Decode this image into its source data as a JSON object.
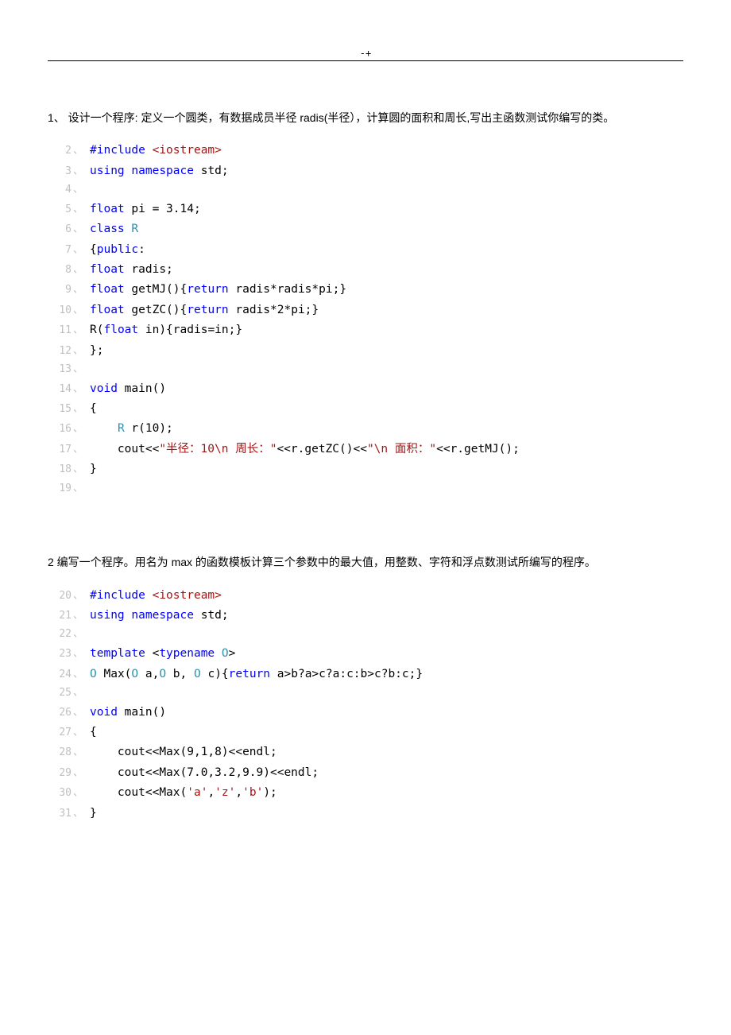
{
  "header": {
    "mark": "-+"
  },
  "q1": {
    "text": "1、 设计一个程序: 定义一个圆类，有数据成员半径 radis(半径），计算圆的面积和周长,写出主函数测试你编写的类。",
    "lines": [
      {
        "n": "2",
        "tokens": [
          [
            "pp",
            "#include "
          ],
          [
            "inc",
            "<iostream>"
          ]
        ]
      },
      {
        "n": "3",
        "tokens": [
          [
            "kw",
            "using"
          ],
          [
            "blk",
            " "
          ],
          [
            "kw",
            "namespace"
          ],
          [
            "blk",
            " std;"
          ]
        ]
      },
      {
        "n": "4",
        "tokens": []
      },
      {
        "n": "5",
        "tokens": [
          [
            "kw",
            "float"
          ],
          [
            "blk",
            " pi = 3.14;"
          ]
        ]
      },
      {
        "n": "6",
        "tokens": [
          [
            "kw",
            "class"
          ],
          [
            "blk",
            " "
          ],
          [
            "cls",
            "R"
          ]
        ]
      },
      {
        "n": "7",
        "tokens": [
          [
            "blk",
            "{"
          ],
          [
            "kw",
            "public"
          ],
          [
            "blk",
            ":"
          ]
        ]
      },
      {
        "n": "8",
        "tokens": [
          [
            "kw",
            "float"
          ],
          [
            "blk",
            " radis;"
          ]
        ]
      },
      {
        "n": "9",
        "tokens": [
          [
            "kw",
            "float"
          ],
          [
            "blk",
            " getMJ(){"
          ],
          [
            "kw",
            "return"
          ],
          [
            "blk",
            " radis*radis*pi;}"
          ]
        ]
      },
      {
        "n": "10",
        "tokens": [
          [
            "kw",
            "float"
          ],
          [
            "blk",
            " getZC(){"
          ],
          [
            "kw",
            "return"
          ],
          [
            "blk",
            " radis*2*pi;}"
          ]
        ]
      },
      {
        "n": "11",
        "tokens": [
          [
            "blk",
            "R("
          ],
          [
            "kw",
            "float"
          ],
          [
            "blk",
            " in){radis=in;}"
          ]
        ]
      },
      {
        "n": "12",
        "tokens": [
          [
            "blk",
            "};"
          ]
        ]
      },
      {
        "n": "13",
        "tokens": []
      },
      {
        "n": "14",
        "tokens": [
          [
            "kw",
            "void"
          ],
          [
            "blk",
            " main()"
          ]
        ]
      },
      {
        "n": "15",
        "tokens": [
          [
            "blk",
            "{"
          ]
        ]
      },
      {
        "n": "16",
        "tokens": [
          [
            "blk",
            "    "
          ],
          [
            "cls",
            "R"
          ],
          [
            "blk",
            " r(10);"
          ]
        ]
      },
      {
        "n": "17",
        "tokens": [
          [
            "blk",
            "    cout<<"
          ],
          [
            "str",
            "\"半径：10\\n 周长："
          ],
          [
            "str",
            "\""
          ],
          [
            "blk",
            "<<r.getZC()<<"
          ],
          [
            "str",
            "\"\\n 面积：\""
          ],
          [
            "blk",
            "<<r.getMJ();"
          ]
        ]
      },
      {
        "n": "18",
        "tokens": [
          [
            "blk",
            "}"
          ]
        ]
      },
      {
        "n": "19",
        "tokens": []
      }
    ]
  },
  "q2": {
    "text": "2 编写一个程序。用名为 max 的函数模板计算三个参数中的最大值，用整数、字符和浮点数测试所编写的程序。",
    "lines": [
      {
        "n": "20",
        "tokens": [
          [
            "pp",
            "#include "
          ],
          [
            "inc",
            "<iostream>"
          ]
        ]
      },
      {
        "n": "21",
        "tokens": [
          [
            "kw",
            "using"
          ],
          [
            "blk",
            " "
          ],
          [
            "kw",
            "namespace"
          ],
          [
            "blk",
            " std;"
          ]
        ]
      },
      {
        "n": "22",
        "tokens": []
      },
      {
        "n": "23",
        "tokens": [
          [
            "kw",
            "template"
          ],
          [
            "blk",
            " <"
          ],
          [
            "kw",
            "typename"
          ],
          [
            "blk",
            " "
          ],
          [
            "cls",
            "O"
          ],
          [
            "blk",
            ">"
          ]
        ]
      },
      {
        "n": "24",
        "tokens": [
          [
            "cls",
            "O"
          ],
          [
            "blk",
            " Max("
          ],
          [
            "cls",
            "O"
          ],
          [
            "blk",
            " a,"
          ],
          [
            "cls",
            "O"
          ],
          [
            "blk",
            " b, "
          ],
          [
            "cls",
            "O"
          ],
          [
            "blk",
            " c){"
          ],
          [
            "kw",
            "return"
          ],
          [
            "blk",
            " a>b?a>c?a:c:b>c?b:c;}"
          ]
        ]
      },
      {
        "n": "25",
        "tokens": []
      },
      {
        "n": "26",
        "tokens": [
          [
            "kw",
            "void"
          ],
          [
            "blk",
            " main()"
          ]
        ]
      },
      {
        "n": "27",
        "tokens": [
          [
            "blk",
            "{"
          ]
        ]
      },
      {
        "n": "28",
        "tokens": [
          [
            "blk",
            "    cout<<Max(9,1,8)<<endl;"
          ]
        ]
      },
      {
        "n": "29",
        "tokens": [
          [
            "blk",
            "    cout<<Max(7.0,3.2,9.9)<<endl;"
          ]
        ]
      },
      {
        "n": "30",
        "tokens": [
          [
            "blk",
            "    cout<<Max("
          ],
          [
            "str",
            "'a'"
          ],
          [
            "blk",
            ","
          ],
          [
            "str",
            "'z'"
          ],
          [
            "blk",
            ","
          ],
          [
            "str",
            "'b'"
          ],
          [
            "blk",
            ");"
          ]
        ]
      },
      {
        "n": "31",
        "tokens": [
          [
            "blk",
            "}"
          ]
        ]
      }
    ]
  }
}
